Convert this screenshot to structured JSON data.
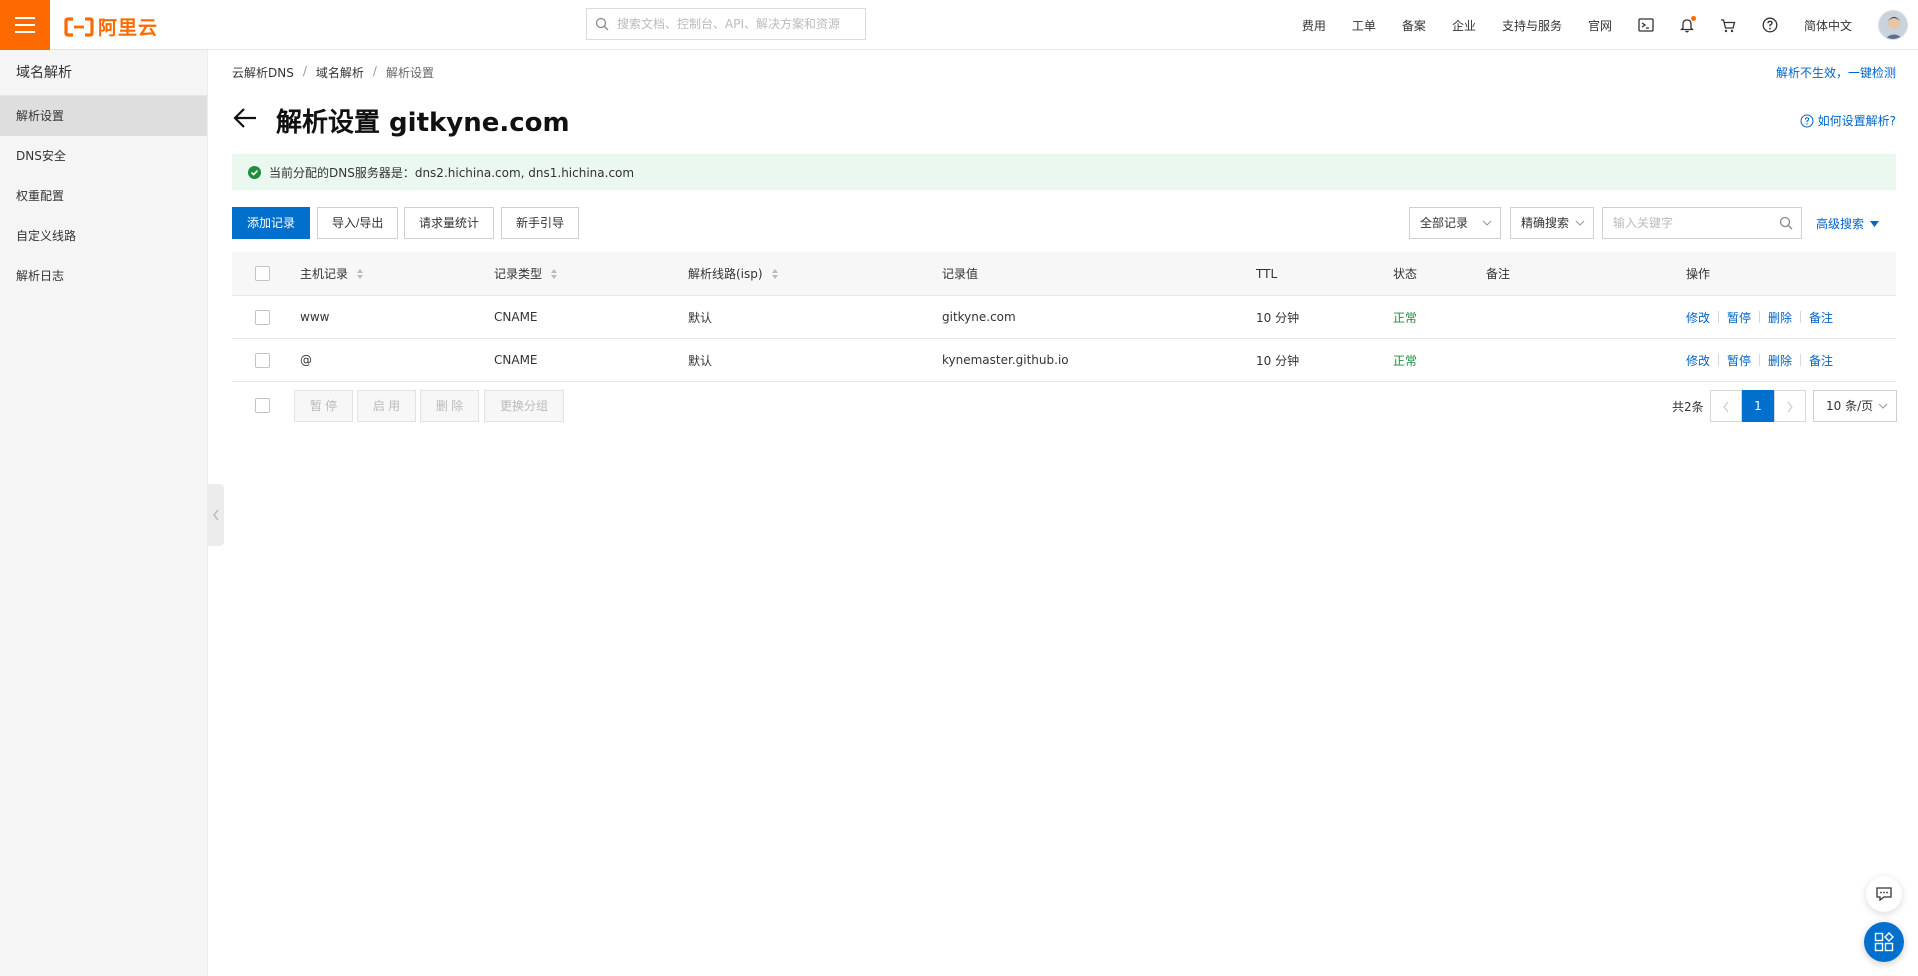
{
  "topbar": {
    "logo_text": "阿里云",
    "search_placeholder": "搜索文档、控制台、API、解决方案和资源",
    "nav": [
      "费用",
      "工单",
      "备案",
      "企业",
      "支持与服务",
      "官网"
    ],
    "language": "简体中文",
    "accent_color": "#ff6a00"
  },
  "sidebar": {
    "title": "域名解析",
    "items": [
      "解析设置",
      "DNS安全",
      "权重配置",
      "自定义线路",
      "解析日志"
    ],
    "active_index": 0
  },
  "breadcrumb": [
    "云解析DNS",
    "域名解析",
    "解析设置"
  ],
  "top_link": "解析不生效，一键检测",
  "page": {
    "title": "解析设置 gitkyne.com",
    "help_link": "如何设置解析?"
  },
  "notice": {
    "text": "当前分配的DNS服务器是：dns2.hichina.com, dns1.hichina.com"
  },
  "toolbar": {
    "add_record": "添加记录",
    "import_export": "导入/导出",
    "request_stats": "请求量统计",
    "guide": "新手引导",
    "filter_all": "全部记录",
    "filter_exact": "精确搜索",
    "keyword_placeholder": "输入关键字",
    "advanced_search": "高级搜索"
  },
  "table": {
    "headers": {
      "host": "主机记录",
      "type": "记录类型",
      "line": "解析线路(isp)",
      "value": "记录值",
      "ttl": "TTL",
      "status": "状态",
      "remark": "备注",
      "actions": "操作"
    },
    "rows": [
      {
        "host": "www",
        "type": "CNAME",
        "line": "默认",
        "value": "gitkyne.com",
        "ttl": "10 分钟",
        "status": "正常",
        "remark": ""
      },
      {
        "host": "@",
        "type": "CNAME",
        "line": "默认",
        "value": "kynemaster.github.io",
        "ttl": "10 分钟",
        "status": "正常",
        "remark": ""
      }
    ],
    "row_actions": [
      "修改",
      "暂停",
      "删除",
      "备注"
    ]
  },
  "batch": {
    "pause": "暂 停",
    "enable": "启 用",
    "delete": "删 除",
    "change_group": "更换分组"
  },
  "pagination": {
    "total": "共2条",
    "current_page": "1",
    "page_size": "10 条/页"
  }
}
